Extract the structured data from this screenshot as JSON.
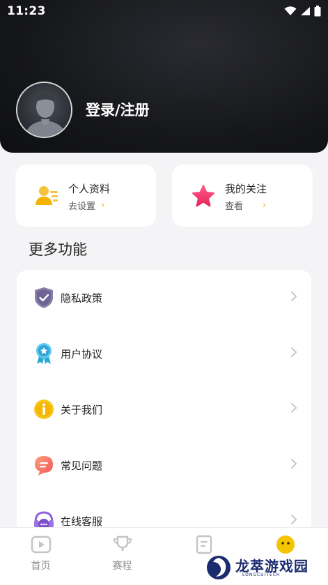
{
  "status_bar": {
    "time": "11:23"
  },
  "header": {
    "login_label": "登录/注册"
  },
  "cards": [
    {
      "title": "个人资料",
      "subtitle": "去设置",
      "chevron": "›",
      "icon": "profile-card-icon",
      "color": "#f2b400"
    },
    {
      "title": "我的关注",
      "subtitle": "查看",
      "chevron": "›",
      "icon": "star-icon",
      "color": "#f0386b"
    }
  ],
  "section": {
    "title": "更多功能"
  },
  "menu": [
    {
      "label": "隐私政策",
      "icon": "shield-check-icon"
    },
    {
      "label": "用户协议",
      "icon": "badge-ribbon-icon"
    },
    {
      "label": "关于我们",
      "icon": "info-icon"
    },
    {
      "label": "常见问题",
      "icon": "chat-bubble-icon"
    },
    {
      "label": "在线客服",
      "icon": "headset-icon"
    }
  ],
  "tabbar": [
    {
      "label": "首页",
      "icon": "play-icon"
    },
    {
      "label": "赛程",
      "icon": "trophy-icon"
    },
    {
      "label": "",
      "icon": "document-icon"
    },
    {
      "label": "",
      "icon": "face-icon"
    }
  ],
  "watermark": {
    "title": "龙萃游戏园",
    "subtitle": "LONGCUITECH"
  },
  "colors": {
    "accent": "#f2b400",
    "header_bg": "#16171b",
    "page_bg": "#f4f4f6"
  }
}
